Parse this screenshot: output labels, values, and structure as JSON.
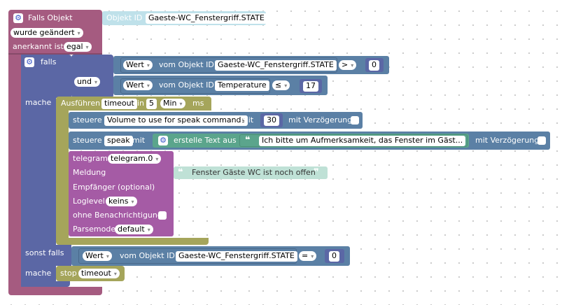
{
  "colors": {
    "event": "#a55b80",
    "logic": "#5b67a5",
    "compare": "#5b80a5",
    "timer": "#a5a55b",
    "action": "#5b80a5",
    "text": "#5ba58c",
    "telegram": "#a55ba5",
    "id_block": "#bfe1ea"
  },
  "trigger": {
    "title": "Falls Objekt",
    "object_id_label": "Objekt ID",
    "object_id_value": "Gaeste-WC_Fenstergriff.STATE",
    "changed_dropdown": "wurde geändert",
    "ack_label": "anerkannt ist",
    "ack_dropdown": "egal"
  },
  "if_block": {
    "falls_label": "falls",
    "und_dropdown": "und",
    "mache_label": "mache",
    "sonst_falls_label": "sonst falls",
    "mache2_label": "mache"
  },
  "cond1": {
    "value_dropdown": "Wert",
    "from_label": "vom Objekt ID",
    "object": "Gaeste-WC_Fenstergriff.STATE",
    "op": ">",
    "number": "0"
  },
  "cond2": {
    "value_dropdown": "Wert",
    "from_label": "vom Objekt ID",
    "object": "Temperature",
    "op": "≤",
    "number": "17"
  },
  "timeout_block": {
    "exec_label": "Ausführen",
    "var_name": "timeout",
    "in_label": "in",
    "amount": "5",
    "unit_dropdown": "Min",
    "ms_label": "ms"
  },
  "set_volume": {
    "steuere_label": "steuere",
    "target": "Volume to use for speak commands",
    "mit_label": "mit",
    "value": "30",
    "delay_label": "mit Verzögerung"
  },
  "set_speak": {
    "steuere_label": "steuere",
    "target": "speak",
    "mit_label": "mit",
    "create_text_label": "erstelle Text aus",
    "text_value": "Ich bitte um Aufmerksamkeit, das Fenster im Gäst...",
    "delay_label": "mit Verzögerung"
  },
  "telegram": {
    "label": "telegram",
    "instance_dropdown": "telegram.0",
    "message_label": "Meldung",
    "message_text": "Fenster Gäste WC ist noch offen",
    "recipient_label": "Empfänger (optional)",
    "loglevel_label": "Loglevel",
    "loglevel_dropdown": "keins",
    "no_notify_label": "ohne Benachrichtigung",
    "parsemode_label": "Parsemode",
    "parsemode_dropdown": "default"
  },
  "cond3": {
    "value_dropdown": "Wert",
    "from_label": "vom Objekt ID",
    "object": "Gaeste-WC_Fenstergriff.STATE",
    "op": "=",
    "number": "0"
  },
  "stop_block": {
    "stop_label": "stop",
    "var_dropdown": "timeout"
  },
  "icons": {
    "gear": "⚙",
    "arrow": "▾",
    "open_quote": "❝",
    "close_quote": "❞"
  }
}
